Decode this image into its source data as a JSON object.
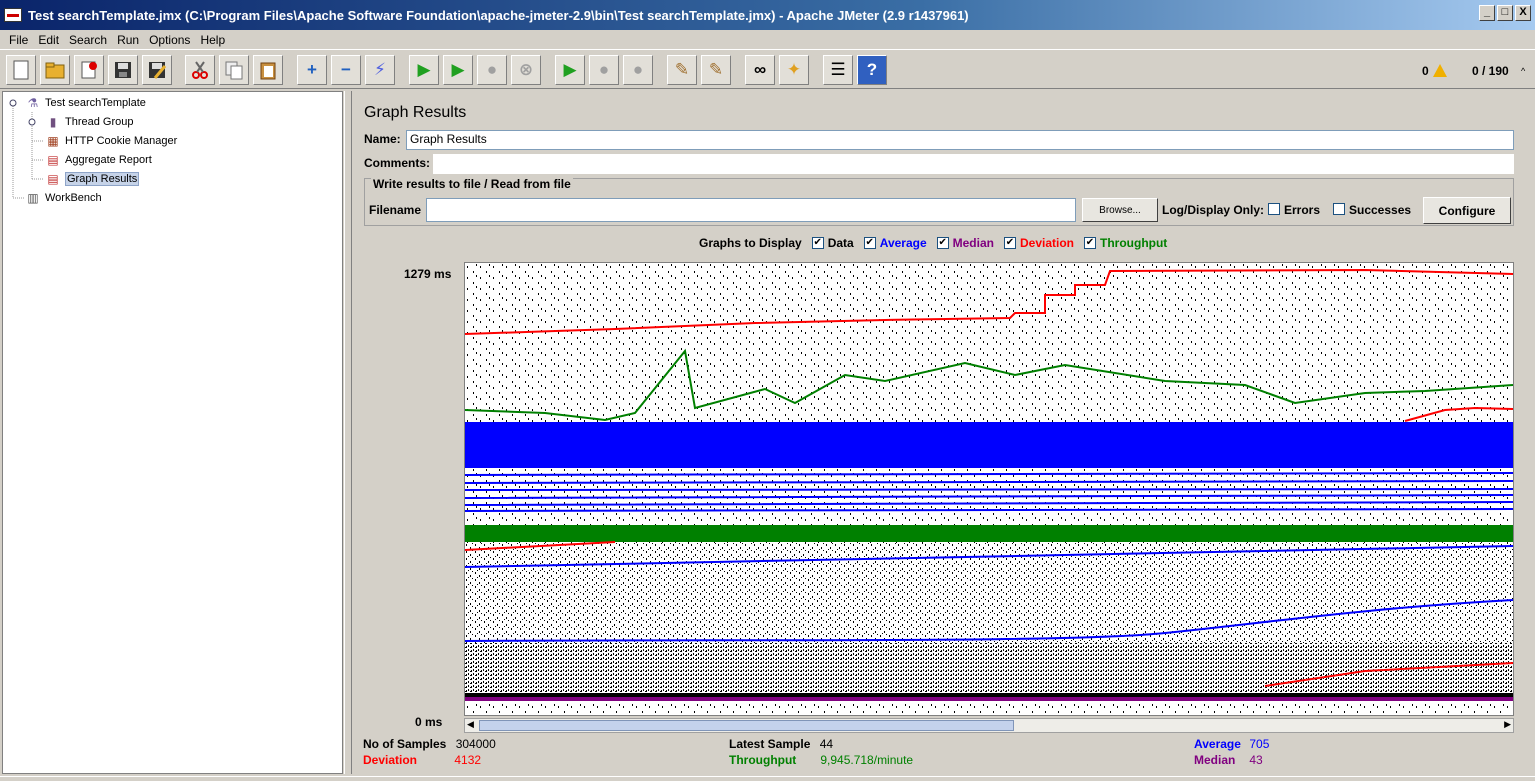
{
  "window": {
    "title": "Test searchTemplate.jmx (C:\\Program Files\\Apache Software Foundation\\apache-jmeter-2.9\\bin\\Test searchTemplate.jmx) - Apache JMeter (2.9 r1437961)",
    "buttons": [
      "_",
      "□",
      "X"
    ]
  },
  "menu": [
    "File",
    "Edit",
    "Search",
    "Run",
    "Options",
    "Help"
  ],
  "toolbar": {
    "icons": [
      "new-icon",
      "open-icon",
      "close-icon",
      "save-icon",
      "save-as-icon",
      "cut-icon",
      "copy-icon",
      "paste-icon",
      "expand-icon",
      "collapse-icon",
      "toggle-icon",
      "start-icon",
      "start-no-pause-icon",
      "stop-icon",
      "shutdown-icon",
      "remote-start-icon",
      "remote-stop-icon",
      "remote-shutdown-icon",
      "clear-icon",
      "clear-all-icon",
      "search-icon",
      "reset-search-icon",
      "function-helper-icon",
      "help-icon"
    ],
    "warning_count": "0",
    "thread_status": "0 / 190"
  },
  "tree": {
    "items": [
      {
        "label": "Test searchTemplate",
        "icon": "test-plan-icon"
      },
      {
        "label": "Thread Group",
        "icon": "thread-group-icon"
      },
      {
        "label": "HTTP Cookie Manager",
        "icon": "cookie-manager-icon"
      },
      {
        "label": "Aggregate Report",
        "icon": "report-icon"
      },
      {
        "label": "Graph Results",
        "icon": "graph-icon"
      },
      {
        "label": "WorkBench",
        "icon": "workbench-icon"
      }
    ]
  },
  "panel": {
    "title": "Graph Results",
    "name_label": "Name:",
    "name_value": "Graph Results",
    "comments_label": "Comments:",
    "file_section_title": "Write results to file / Read from file",
    "filename_label": "Filename",
    "filename_value": "",
    "browse_label": "Browse...",
    "log_display_label": "Log/Display Only:",
    "errors_label": "Errors",
    "successes_label": "Successes",
    "configure_label": "Configure",
    "graphs_to_display_label": "Graphs to Display",
    "options": [
      {
        "label": "Data",
        "color": "#000000",
        "checked": true
      },
      {
        "label": "Average",
        "color": "#0000ff",
        "checked": true
      },
      {
        "label": "Median",
        "color": "#800080",
        "checked": true
      },
      {
        "label": "Deviation",
        "color": "#ff0000",
        "checked": true
      },
      {
        "label": "Throughput",
        "color": "#008000",
        "checked": true
      }
    ],
    "y_max_label": "1279  ms",
    "y_min_label": "0  ms"
  },
  "stats": {
    "no_of_samples_label": "No of Samples",
    "no_of_samples": "304000",
    "latest_sample_label": "Latest Sample",
    "latest_sample": "44",
    "average_label": "Average",
    "average": "705",
    "deviation_label": "Deviation",
    "deviation": "4132",
    "throughput_label": "Throughput",
    "throughput": "9,945.718/minute",
    "median_label": "Median",
    "median": "43"
  },
  "colors": {
    "data": "#000000",
    "average": "#0000ff",
    "median": "#800080",
    "deviation": "#ff0000",
    "throughput": "#008000"
  }
}
